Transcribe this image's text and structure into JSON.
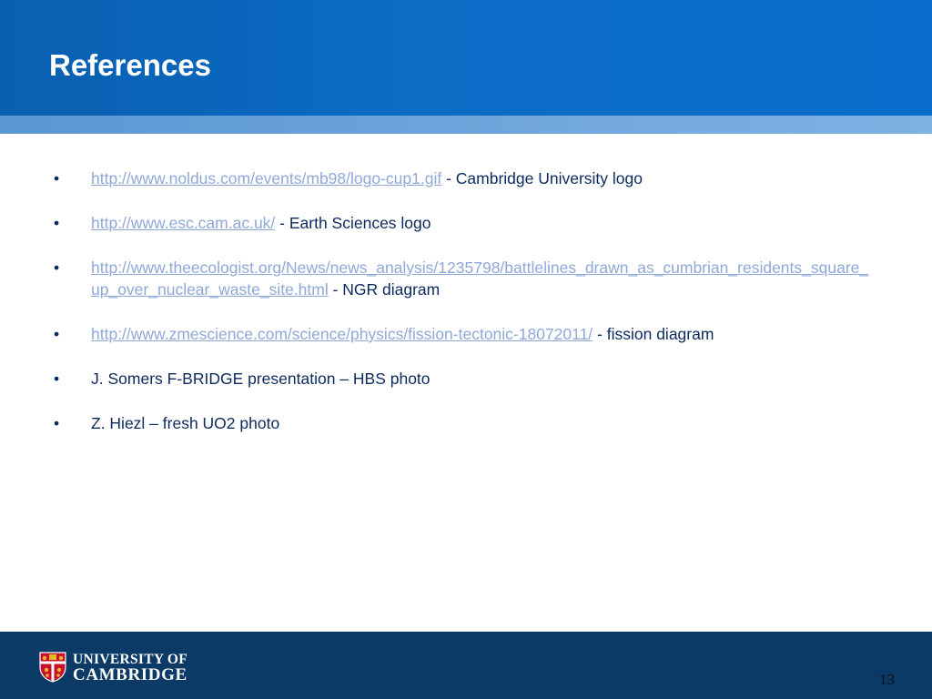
{
  "slide": {
    "title": "References",
    "page_number": "13"
  },
  "references": [
    {
      "link": "http://www.noldus.com/events/mb98/logo-cup1.gif",
      "text": " - Cambridge University logo"
    },
    {
      "link": "http://www.esc.cam.ac.uk/",
      "text": " - Earth Sciences logo"
    },
    {
      "link": "http://www.theecologist.org/News/news_analysis/1235798/battlelines_drawn_as_cumbrian_residents_square_up_over_nuclear_waste_site.html",
      "text": " - NGR diagram"
    },
    {
      "link": "http://www.zmescience.com/science/physics/fission-tectonic-18072011/",
      "text": " - fission diagram"
    },
    {
      "link": "",
      "text": "J. Somers F-BRIDGE presentation – HBS photo"
    },
    {
      "link": "",
      "text": "Z. Hiezl – fresh UO2 photo"
    }
  ],
  "footer": {
    "logo_line1": "UNIVERSITY OF",
    "logo_line2": "CAMBRIDGE"
  },
  "bullet": "•",
  "colors": {
    "header": "#0b6cc6",
    "band": "#6ea6de",
    "footer": "#0b3a66",
    "text": "#0c2a5c",
    "link": "#8fa8d8"
  }
}
